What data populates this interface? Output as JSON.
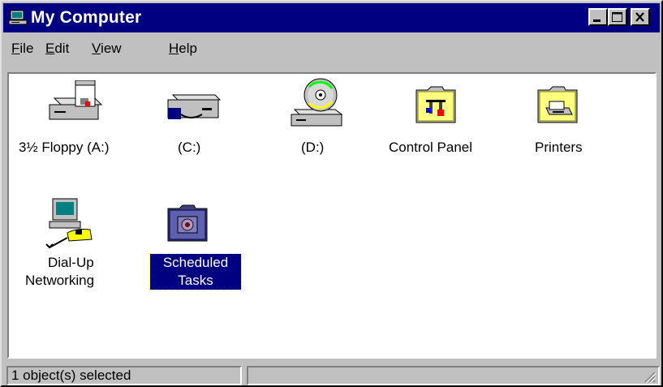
{
  "window": {
    "title": "My Computer"
  },
  "menu": [
    {
      "pre": "",
      "key": "F",
      "post": "ile"
    },
    {
      "pre": "",
      "key": "E",
      "post": "dit"
    },
    {
      "pre": "",
      "key": "V",
      "post": "iew"
    },
    {
      "pre": "",
      "key": "H",
      "post": "elp"
    }
  ],
  "items": [
    {
      "label": "3½ Floppy (A:)",
      "icon": "floppy-drive-icon"
    },
    {
      "label": "(C:)",
      "icon": "hard-drive-icon"
    },
    {
      "label": "(D:)",
      "icon": "cd-drive-icon"
    },
    {
      "label": "Control Panel",
      "icon": "control-panel-folder-icon"
    },
    {
      "label": "Printers",
      "icon": "printers-folder-icon"
    },
    {
      "label_line1": "Dial-Up",
      "label_line2": "Networking",
      "icon": "dial-up-networking-icon"
    },
    {
      "label_line1": "Scheduled",
      "label_line2": "Tasks",
      "icon": "scheduled-tasks-folder-icon",
      "selected": true
    }
  ],
  "status": {
    "text": "1 object(s) selected",
    "secondary": ""
  },
  "colors": {
    "titlebar": "#000080",
    "face": "#c0c0c0",
    "selection": "#000080"
  }
}
